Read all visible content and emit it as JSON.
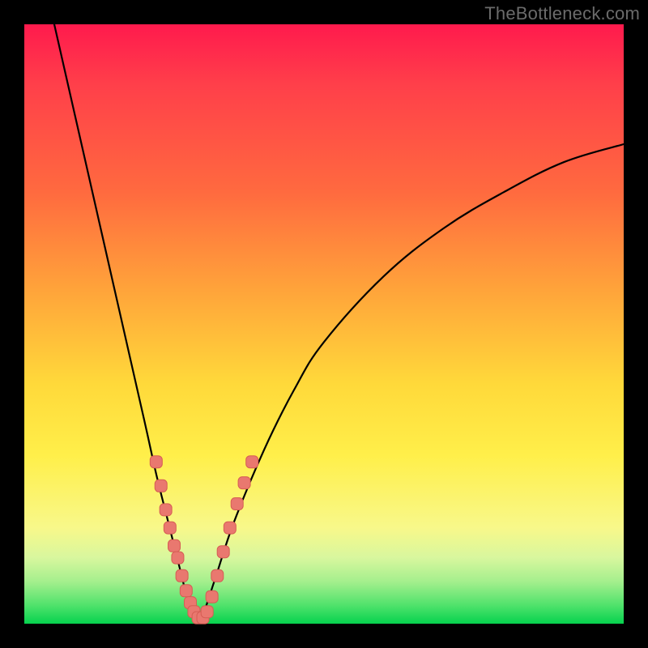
{
  "watermark": "TheBottleneck.com",
  "colors": {
    "curve_stroke": "#000000",
    "marker_fill": "#e9786f",
    "marker_stroke": "#d65d54",
    "frame_bg": "#000000"
  },
  "chart_data": {
    "type": "line",
    "title": "",
    "xlabel": "",
    "ylabel": "",
    "xlim": [
      0,
      100
    ],
    "ylim": [
      0,
      100
    ],
    "series": [
      {
        "name": "bottleneck-curve",
        "x": [
          5,
          10,
          15,
          20,
          22,
          24,
          26,
          27,
          28,
          29,
          30,
          32,
          35,
          40,
          45,
          50,
          60,
          70,
          80,
          90,
          100
        ],
        "y": [
          100,
          78,
          56,
          34,
          25,
          17,
          9,
          5,
          2,
          0,
          2,
          8,
          17,
          29,
          39,
          47,
          58,
          66,
          72,
          77,
          80
        ]
      }
    ],
    "markers": [
      {
        "x": 22.0,
        "y": 27
      },
      {
        "x": 22.8,
        "y": 23
      },
      {
        "x": 23.6,
        "y": 19
      },
      {
        "x": 24.3,
        "y": 16
      },
      {
        "x": 25.0,
        "y": 13
      },
      {
        "x": 25.6,
        "y": 11
      },
      {
        "x": 26.3,
        "y": 8
      },
      {
        "x": 27.0,
        "y": 5.5
      },
      {
        "x": 27.7,
        "y": 3.5
      },
      {
        "x": 28.3,
        "y": 2
      },
      {
        "x": 29.0,
        "y": 1
      },
      {
        "x": 29.8,
        "y": 1
      },
      {
        "x": 30.5,
        "y": 2
      },
      {
        "x": 31.3,
        "y": 4.5
      },
      {
        "x": 32.2,
        "y": 8
      },
      {
        "x": 33.2,
        "y": 12
      },
      {
        "x": 34.3,
        "y": 16
      },
      {
        "x": 35.5,
        "y": 20
      },
      {
        "x": 36.7,
        "y": 23.5
      },
      {
        "x": 38.0,
        "y": 27
      }
    ]
  }
}
